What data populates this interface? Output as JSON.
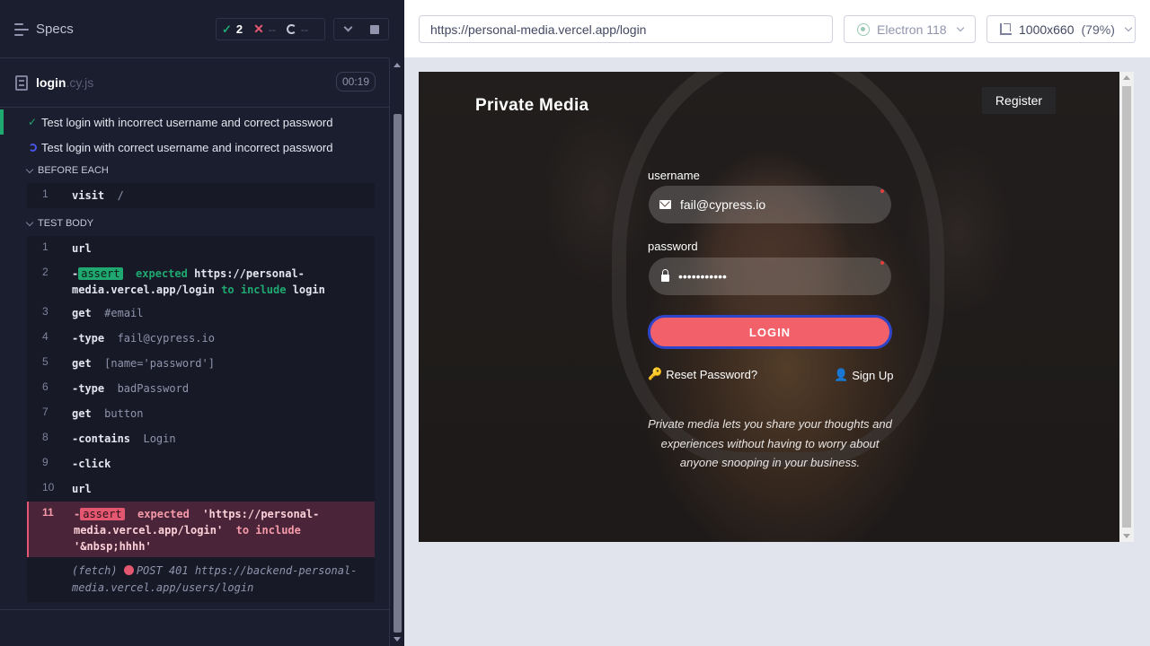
{
  "reporter": {
    "specs_label": "Specs",
    "stats": {
      "passed": "2",
      "failed": "--",
      "pending": "--"
    },
    "spec": {
      "name": "login",
      "ext": ".cy.js",
      "duration": "00:19"
    },
    "tests": [
      {
        "title": "Test login with incorrect username and correct password",
        "state": "passed"
      },
      {
        "title": "Test login with correct username and incorrect password",
        "state": "running"
      }
    ],
    "hooks": {
      "before_each_label": "BEFORE EACH",
      "test_body_label": "TEST BODY"
    },
    "before_each": [
      {
        "num": "1",
        "cmd": "visit",
        "arg": "/"
      }
    ],
    "body": [
      {
        "num": "1",
        "cmd": "url"
      },
      {
        "num": "2",
        "pill": "assert",
        "expected": "expected",
        "value": "https://personal-media.vercel.app/login",
        "to": "to include",
        "value2": "login"
      },
      {
        "num": "3",
        "cmd": "get",
        "arg": "#email"
      },
      {
        "num": "4",
        "cmd": "-type",
        "arg": "fail@cypress.io"
      },
      {
        "num": "5",
        "cmd": "get",
        "arg": "[name='password']"
      },
      {
        "num": "6",
        "cmd": "-type",
        "arg": "badPassword"
      },
      {
        "num": "7",
        "cmd": "get",
        "arg": "button"
      },
      {
        "num": "8",
        "cmd": "-contains",
        "arg": "Login"
      },
      {
        "num": "9",
        "cmd": "-click"
      },
      {
        "num": "10",
        "cmd": "url"
      },
      {
        "num": "11",
        "pill": "assert",
        "expected": "expected",
        "value": "'https://personal-media.vercel.app/login'",
        "to": "to include",
        "value2": "'&nbsp;hhhh'"
      }
    ],
    "fetch": {
      "label": "(fetch)",
      "text": "POST 401 https://backend-personal-media.vercel.app/users/login"
    }
  },
  "aut": {
    "url": "https://personal-media.vercel.app/login",
    "browser": "Electron 118",
    "viewport": "1000x660",
    "scale": "(79%)"
  },
  "app": {
    "brand": "Private Media",
    "register_label": "Register",
    "username_label": "username",
    "username_value": "fail@cypress.io",
    "password_label": "password",
    "password_value": "•••••••••••",
    "login_label": "LOGIN",
    "reset_label": "Reset Password?",
    "signup_label": "Sign Up",
    "tagline": "Private media lets you share your thoughts and experiences without having to worry about anyone snooping in your business."
  },
  "colors": {
    "pass": "#1fa971",
    "fail": "#e45770",
    "login_button": "#f2606a",
    "focus_ring": "#2f45c9"
  },
  "icons": [
    "menu-icon",
    "check-icon",
    "x-icon",
    "spinner-icon",
    "chevron-down-icon",
    "stop-icon",
    "file-icon",
    "electron-icon",
    "ruler-icon",
    "mail-icon",
    "lock-icon",
    "key-icon",
    "user-plus-icon"
  ]
}
